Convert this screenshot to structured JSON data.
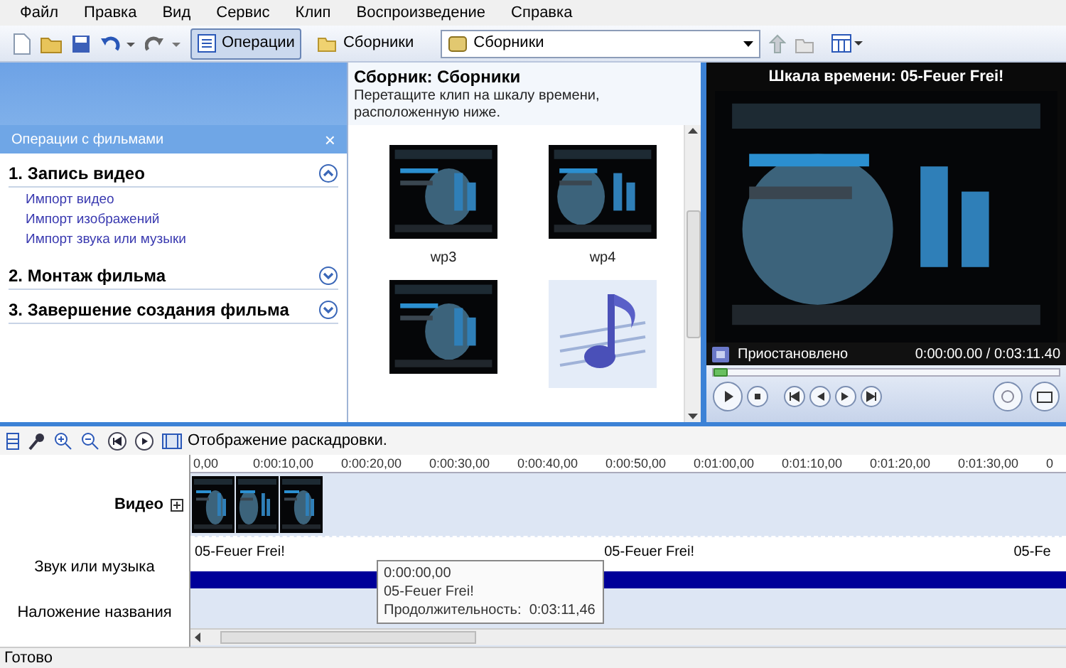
{
  "menu": [
    "Файл",
    "Правка",
    "Вид",
    "Сервис",
    "Клип",
    "Воспроизведение",
    "Справка"
  ],
  "toolbar": {
    "toggles": [
      {
        "label": "Операции",
        "selected": true
      },
      {
        "label": "Сборники",
        "selected": false
      }
    ],
    "collection_select": "Сборники"
  },
  "tasks_pane": {
    "title": "Операции с фильмами",
    "close": "×",
    "sections": [
      {
        "title": "1. Запись видео",
        "expanded": true,
        "links": [
          "Импорт видео",
          "Импорт изображений",
          "Импорт звука или музыки"
        ]
      },
      {
        "title": "2. Монтаж фильма",
        "expanded": false
      },
      {
        "title": "3. Завершение создания фильма",
        "expanded": false
      }
    ]
  },
  "collection": {
    "title": "Сборник: Сборники",
    "hint": "Перетащите клип на шкалу времени, расположенную ниже.",
    "items": [
      {
        "kind": "picture",
        "label": "wp3"
      },
      {
        "kind": "picture",
        "label": "wp4"
      },
      {
        "kind": "picture"
      },
      {
        "kind": "audio"
      }
    ]
  },
  "preview": {
    "title": "Шкала времени: 05-Feuer Frei!",
    "status": "Приостановлено",
    "time": "0:00:00.00 / 0:03:11.40",
    "level": 0
  },
  "timeline": {
    "view_toggle": "Отображение раскадровки.",
    "ruler": [
      "0,00",
      "0:00:10,00",
      "0:00:20,00",
      "0:00:30,00",
      "0:00:40,00",
      "0:00:50,00",
      "0:01:00,00",
      "0:01:10,00",
      "0:01:20,00",
      "0:01:30,00",
      "0"
    ],
    "tracks": [
      {
        "kind": "video",
        "label": "Видео",
        "clips": [
          {
            "kind": "picture"
          },
          {
            "kind": "picture"
          },
          {
            "kind": "picture"
          }
        ]
      },
      {
        "kind": "audio",
        "label": "Звук или музыка",
        "clips": [
          "05-Feuer Frei!",
          "05-Feuer Frei!",
          "05-Fe"
        ]
      },
      {
        "kind": "overlay",
        "label": "Наложение названия"
      }
    ],
    "tooltip": [
      "0:00:00,00",
      "05-Feuer Frei!",
      "Продолжительность:  0:03:11,46"
    ]
  },
  "status_bar": "Готово"
}
